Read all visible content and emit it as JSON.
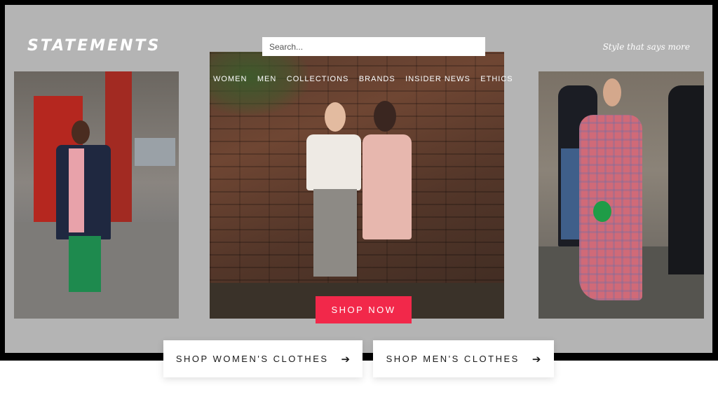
{
  "brand": {
    "logo": "STATEMENTS",
    "tagline": "Style that says more"
  },
  "search": {
    "placeholder": "Search..."
  },
  "nav": {
    "items": [
      {
        "label": "WOMEN"
      },
      {
        "label": "MEN"
      },
      {
        "label": "COLLECTIONS"
      },
      {
        "label": "BRANDS"
      },
      {
        "label": "INSIDER NEWS"
      },
      {
        "label": "ETHICS"
      }
    ]
  },
  "hero": {
    "cta_label": "SHOP NOW",
    "images": [
      {
        "name": "street-style-man-photo"
      },
      {
        "name": "two-women-brick-wall-photo"
      },
      {
        "name": "woman-plaid-dress-photo"
      }
    ]
  },
  "ctas": {
    "women": {
      "label": "SHOP WOMEN'S CLOTHES",
      "icon": "arrow-right-icon"
    },
    "men": {
      "label": "SHOP MEN'S CLOTHES",
      "icon": "arrow-right-icon"
    }
  },
  "colors": {
    "hero_background": "#b4b4b4",
    "accent": "#f2284a",
    "frame": "#000000"
  }
}
